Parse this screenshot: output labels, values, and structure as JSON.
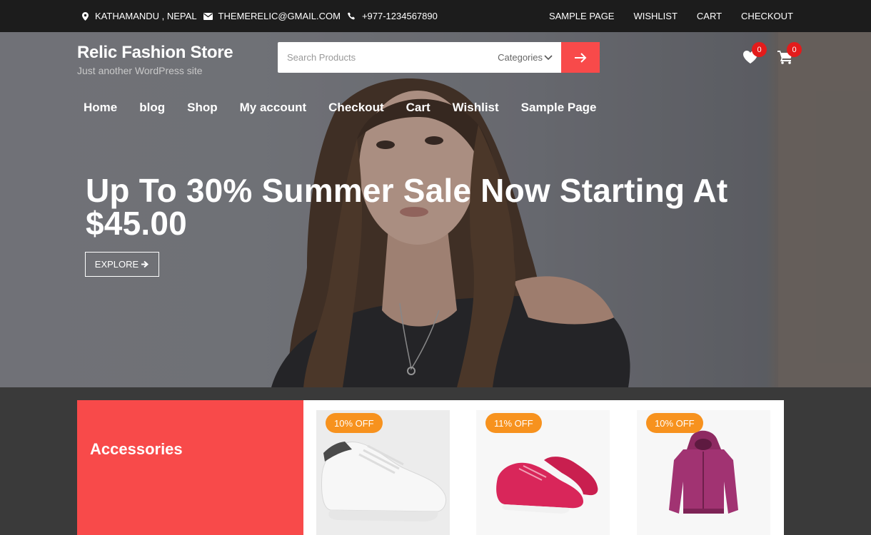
{
  "topbar": {
    "location": "KATHAMANDU , NEPAL",
    "email": "THEMERELIC@GMAIL.COM",
    "phone": "+977-1234567890",
    "links": [
      "SAMPLE PAGE",
      "WISHLIST",
      "CART",
      "CHECKOUT"
    ]
  },
  "site": {
    "title": "Relic Fashion Store",
    "tagline": "Just another WordPress site"
  },
  "search": {
    "placeholder": "Search Products",
    "category_label": "Categories"
  },
  "header_icons": {
    "wishlist_count": "0",
    "cart_count": "0"
  },
  "nav": [
    "Home",
    "blog",
    "Shop",
    "My account",
    "Checkout",
    "Cart",
    "Wishlist",
    "Sample Page"
  ],
  "hero": {
    "headline": "Up To 30% Summer Sale Now Starting At $45.00",
    "button": "EXPLORE"
  },
  "category": {
    "title": "Accessories"
  },
  "products": [
    {
      "discount": "10% OFF",
      "image": "white-sneaker"
    },
    {
      "discount": "11% OFF",
      "image": "pink-sneakers"
    },
    {
      "discount": "10% OFF",
      "image": "magenta-hoodie"
    }
  ],
  "colors": {
    "accent": "#f84a4a",
    "badge": "#f7921e",
    "topbar": "#1c1c1c"
  }
}
